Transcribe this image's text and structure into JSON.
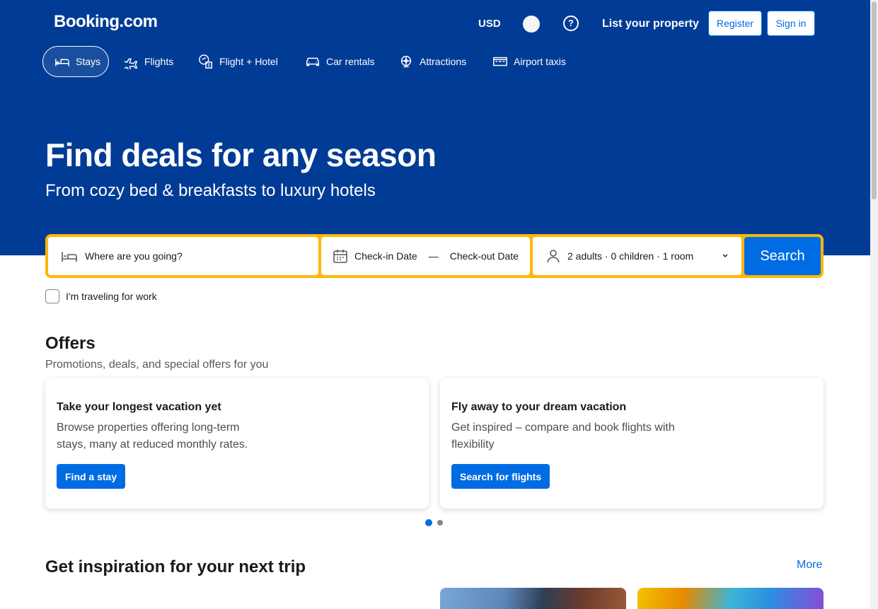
{
  "header": {
    "logo": "Booking.com",
    "currency": "USD",
    "help_label": "?",
    "list_property": "List your property",
    "register": "Register",
    "sign_in": "Sign in"
  },
  "nav": {
    "items": [
      {
        "label": "Stays",
        "icon": "bed-icon",
        "active": true
      },
      {
        "label": "Flights",
        "icon": "plane-icon"
      },
      {
        "label": "Flight + Hotel",
        "icon": "flight-hotel-icon"
      },
      {
        "label": "Car rentals",
        "icon": "car-icon"
      },
      {
        "label": "Attractions",
        "icon": "attractions-icon"
      },
      {
        "label": "Airport taxis",
        "icon": "taxi-icon"
      }
    ]
  },
  "hero": {
    "title": "Find deals for any season",
    "subtitle": "From cozy bed & breakfasts to luxury hotels"
  },
  "search": {
    "destination_placeholder": "Where are you going?",
    "checkin": "Check-in Date",
    "dash": "—",
    "checkout": "Check-out Date",
    "guests": "2 adults · 0 children · 1 room",
    "button": "Search",
    "work_label": "I'm traveling for work"
  },
  "offers": {
    "title": "Offers",
    "subtitle": "Promotions, deals, and special offers for you",
    "cards": [
      {
        "title": "Take your longest vacation yet",
        "description": "Browse properties offering long-term stays, many at reduced monthly rates.",
        "button": "Find a stay"
      },
      {
        "title": "Fly away to your dream vacation",
        "description": "Get inspired – compare and book flights with flexibility",
        "button": "Search for flights"
      }
    ],
    "carousel_pages": 2,
    "carousel_active": 1
  },
  "inspiration": {
    "title": "Get inspiration for your next trip",
    "more": "More"
  },
  "colors": {
    "brand_blue": "#003b95",
    "action_blue": "#006ce4",
    "search_border": "#ffb700"
  }
}
